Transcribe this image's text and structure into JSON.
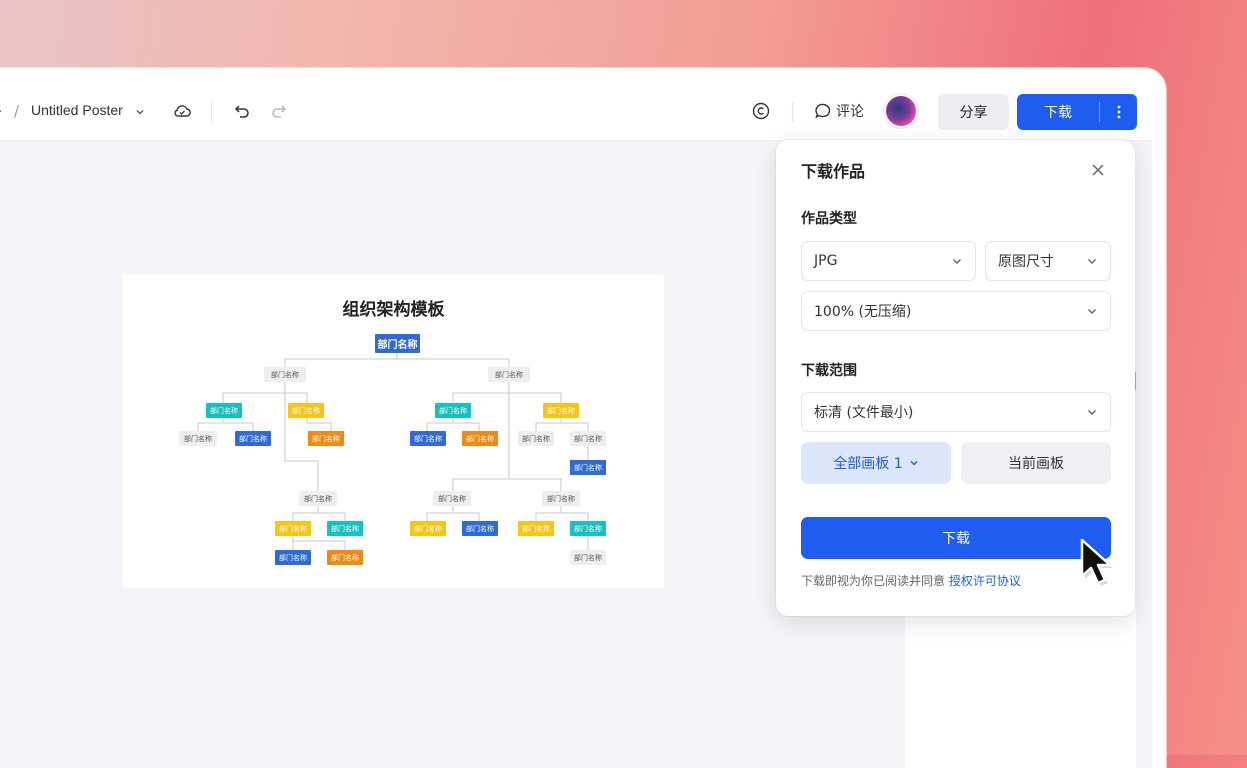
{
  "toolbar": {
    "crumb_prefix": ".",
    "crumb_separator": "/",
    "doc_title": "Untitled Poster",
    "comment_label": "评论",
    "share_label": "分享",
    "download_label": "下载"
  },
  "canvas": {
    "org_title": "组织架构模板",
    "root_label": "部门名称",
    "node_label": "部门名称"
  },
  "download_dialog": {
    "title": "下载作品",
    "type_section_label": "作品类型",
    "format_value": "JPG",
    "size_value": "原图尺寸",
    "quality_value": "100% (无压缩)",
    "range_section_label": "下载范围",
    "resolution_value": "标清 (文件最小)",
    "all_boards_label": "全部画板 1",
    "current_board_label": "当前画板",
    "download_button_label": "下载",
    "note_text": "下载即视为你已阅读并同意 ",
    "license_link_label": "授权许可协议"
  },
  "colors": {
    "accent": "#1f5cf0",
    "node_blue": "#2f6ad9",
    "node_teal": "#18c1bf",
    "node_yellow": "#f5c518",
    "node_orange": "#f08a12"
  }
}
